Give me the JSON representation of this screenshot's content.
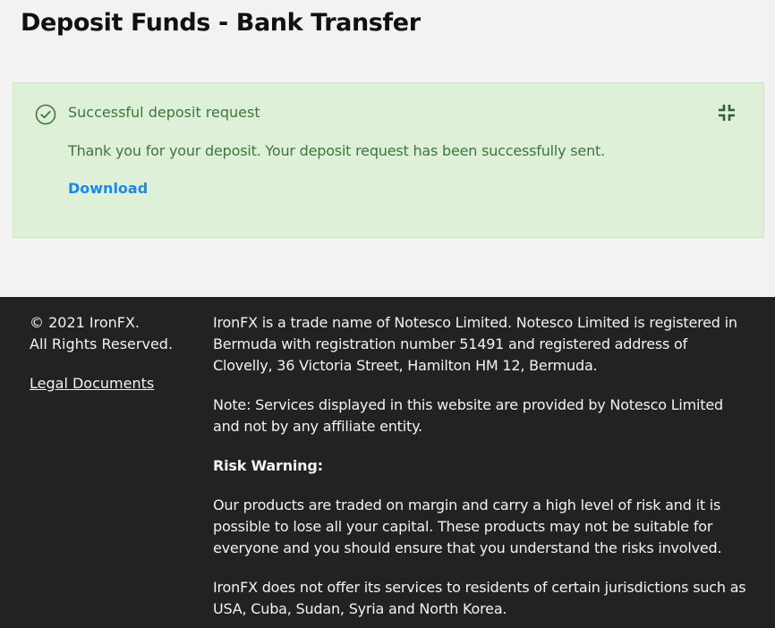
{
  "page": {
    "title": "Deposit Funds - Bank Transfer"
  },
  "alert": {
    "title": "Successful deposit request",
    "message": "Thank you for your deposit. Your deposit request has been successfully sent.",
    "download_label": "Download",
    "status_icon": "check-circle-icon",
    "collapse_icon": "collapse-icon",
    "colors": {
      "background": "#dff0d8",
      "text": "#3c763d",
      "link": "#1e88e5"
    }
  },
  "footer": {
    "copyright_line1": "© 2021 IronFX.",
    "copyright_line2": "All Rights Reserved.",
    "legal_link": "Legal Documents",
    "paragraphs": {
      "company": "IronFX is a trade name of Notesco Limited. Notesco Limited is registered in Bermuda with registration number 51491 and registered address of Clovelly, 36 Victoria Street, Hamilton HM 12, Bermuda.",
      "note": "Note: Services displayed in this website are provided by Notesco Limited and not by any affiliate entity.",
      "risk_heading": "Risk Warning:",
      "risk_text": "Our products are traded on margin and carry a high level of risk and it is possible to lose all your capital. These products may not be suitable for everyone and you should ensure that you understand the risks involved.",
      "jurisdictions": "IronFX does not offer its services to residents of certain jurisdictions such as USA, Cuba, Sudan, Syria and North Korea."
    },
    "colors": {
      "background": "#222222",
      "text": "#f2f2f2"
    }
  }
}
